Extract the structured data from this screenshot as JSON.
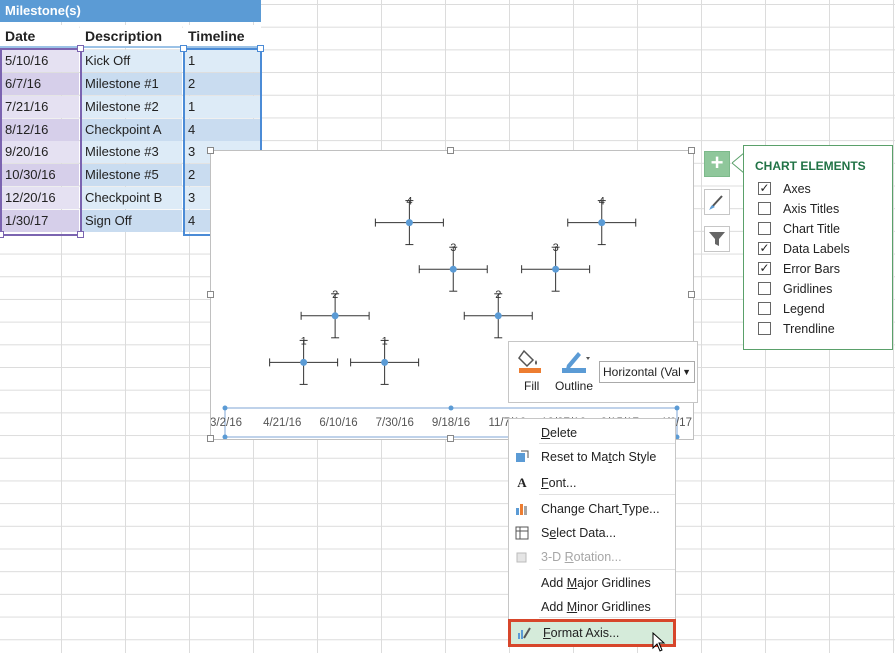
{
  "table": {
    "title": "Milestone(s)",
    "headers": [
      "Date",
      "Description",
      "Timeline"
    ],
    "rows": [
      {
        "date": "5/10/16",
        "description": "Kick Off",
        "timeline": "1"
      },
      {
        "date": "6/7/16",
        "description": "Milestone #1",
        "timeline": "2"
      },
      {
        "date": "7/21/16",
        "description": "Milestone #2",
        "timeline": "1"
      },
      {
        "date": "8/12/16",
        "description": "Checkpoint A",
        "timeline": "4"
      },
      {
        "date": "9/20/16",
        "description": "Milestone #3",
        "timeline": "3"
      },
      {
        "date": "10/30/16",
        "description": "Milestone #5",
        "timeline": "2"
      },
      {
        "date": "12/20/16",
        "description": "Checkpoint B",
        "timeline": "3"
      },
      {
        "date": "1/30/17",
        "description": "Sign Off",
        "timeline": "4"
      }
    ]
  },
  "chart_data": {
    "type": "scatter",
    "x_tick_labels": [
      "3/2/16",
      "4/21/16",
      "6/10/16",
      "7/30/16",
      "9/18/16",
      "11/7/16",
      "12/27/16",
      "2/15/17",
      "4/6/17"
    ],
    "x_tick_dates": [
      "2016-03-02",
      "2016-04-21",
      "2016-06-10",
      "2016-07-30",
      "2016-09-18",
      "2016-11-07",
      "2016-12-27",
      "2017-02-15",
      "2017-04-06"
    ],
    "points": [
      {
        "x": "2016-05-10",
        "y": 1,
        "label": "1"
      },
      {
        "x": "2016-06-07",
        "y": 2,
        "label": "2"
      },
      {
        "x": "2016-07-21",
        "y": 1,
        "label": "1"
      },
      {
        "x": "2016-08-12",
        "y": 4,
        "label": "4"
      },
      {
        "x": "2016-09-20",
        "y": 3,
        "label": "3"
      },
      {
        "x": "2016-10-30",
        "y": 2,
        "label": "2"
      },
      {
        "x": "2016-12-20",
        "y": 3,
        "label": "3"
      },
      {
        "x": "2017-01-30",
        "y": 4,
        "label": "4"
      }
    ],
    "ylim": [
      0,
      5
    ],
    "error_bars": true,
    "data_labels": true,
    "gridlines": false,
    "legend": "none",
    "marker_color": "#5b9bd5"
  },
  "chart_buttons": {
    "plus": "+",
    "style_icon": "paintbrush-icon",
    "filter_icon": "funnel-icon"
  },
  "chart_elements": {
    "title": "CHART ELEMENTS",
    "items": [
      {
        "label": "Axes",
        "checked": true
      },
      {
        "label": "Axis Titles",
        "checked": false
      },
      {
        "label": "Chart Title",
        "checked": false
      },
      {
        "label": "Data Labels",
        "checked": true
      },
      {
        "label": "Error Bars",
        "checked": true
      },
      {
        "label": "Gridlines",
        "checked": false
      },
      {
        "label": "Legend",
        "checked": false
      },
      {
        "label": "Trendline",
        "checked": false
      }
    ]
  },
  "mini_toolbar": {
    "fill_label": "Fill",
    "outline_label": "Outline",
    "selection_value": "Horizontal (Val",
    "fill_color": "#ed7d31",
    "outline_color": "#5b9bd5"
  },
  "context_menu": {
    "items": [
      {
        "label": "Delete",
        "icon": "",
        "disabled": false
      },
      {
        "label": "Reset to Match Style",
        "icon": "reset-style-icon",
        "disabled": false
      },
      {
        "label": "Font...",
        "icon": "font-icon",
        "disabled": false
      },
      {
        "label": "Change Chart Type...",
        "icon": "chart-type-icon",
        "disabled": false
      },
      {
        "label": "Select Data...",
        "icon": "select-data-icon",
        "disabled": false
      },
      {
        "label": "3-D Rotation...",
        "icon": "rotation-icon",
        "disabled": true
      },
      {
        "label": "Add Major Gridlines",
        "icon": "",
        "disabled": false
      },
      {
        "label": "Add Minor Gridlines",
        "icon": "",
        "disabled": false
      },
      {
        "label": "Format Axis...",
        "icon": "format-axis-icon",
        "disabled": false
      }
    ]
  }
}
